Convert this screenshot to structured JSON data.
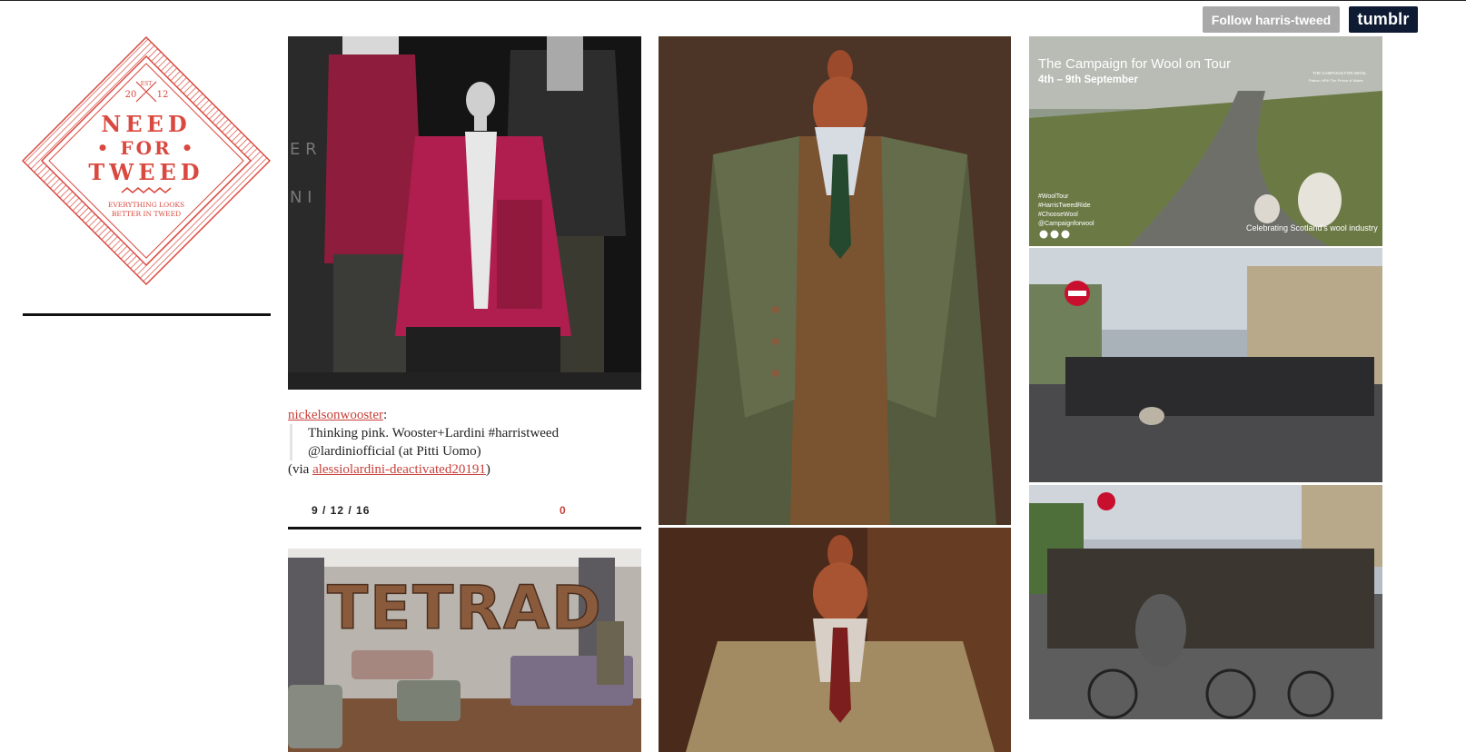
{
  "header": {
    "follow_label": "Follow harris-tweed",
    "tumblr_label": "tumblr"
  },
  "logo": {
    "est": "EST",
    "year_left": "20",
    "year_right": "12",
    "line1": "NEED",
    "line2": "• FOR •",
    "line3": "TWEED",
    "tagline1": "EVERYTHING LOOKS",
    "tagline2": "BETTER IN TWEED",
    "color": "#d9493f"
  },
  "post": {
    "source_user": "nickelsonwooster",
    "quote_line1": "Thinking pink. Wooster+Lardini #harristweed",
    "quote_line2": "@lardiniofficial (at Pitti Uomo)",
    "via_prefix": "(via ",
    "via_user": "alessiolardini-deactivated20191",
    "via_suffix": ")",
    "date": "9 / 12 / 16",
    "notes": "0"
  },
  "images": {
    "tetrad_sign": "TETRAD",
    "campaign_title": "The Campaign for Wool on Tour",
    "campaign_dates": "4th – 9th September",
    "campaign_org": "THE CAMPAIGN FOR WOOL",
    "campaign_patron": "Patron: HRH The Prince of Wales",
    "hashtag1": "#WoolTour",
    "hashtag2": "#HarrisTweedRide",
    "hashtag3": "#ChooseWool",
    "hashtag4": "@Campaignforwool",
    "campaign_footer": "Celebrating Scotland's wool industry"
  },
  "colors": {
    "accent": "#c8403a",
    "tumblr_navy": "#0f1b33",
    "follow_gray": "#a9a9a9"
  }
}
